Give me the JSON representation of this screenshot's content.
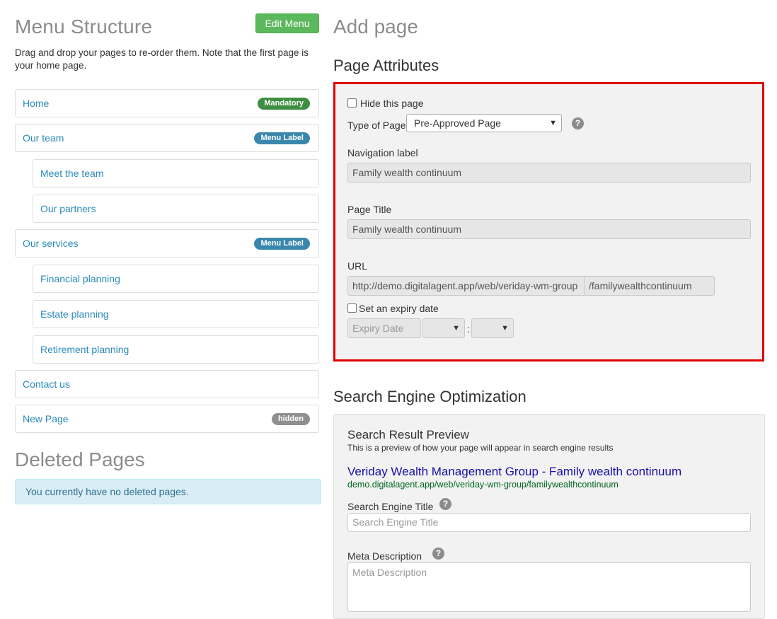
{
  "menu": {
    "heading": "Menu Structure",
    "edit_button": "Edit Menu",
    "intro": "Drag and drop your pages to re-order them. Note that the first page is your home page.",
    "items": [
      {
        "label": "Home",
        "badge": "Mandatory"
      },
      {
        "label": "Our team",
        "badge": "Menu Label"
      },
      {
        "label": "Meet the team"
      },
      {
        "label": "Our partners"
      },
      {
        "label": "Our services",
        "badge": "Menu Label"
      },
      {
        "label": "Financial planning"
      },
      {
        "label": "Estate planning"
      },
      {
        "label": "Retirement planning"
      },
      {
        "label": "Contact us"
      },
      {
        "label": "New Page",
        "badge": "hidden"
      }
    ]
  },
  "deleted": {
    "heading": "Deleted Pages",
    "message": "You currently have no deleted pages."
  },
  "add_page": {
    "heading": "Add page",
    "attributes_heading": "Page Attributes",
    "hide_page_label": "Hide this page",
    "type_label": "Type of Page:",
    "type_value": "Pre-Approved Page",
    "nav_label": "Navigation label",
    "nav_value": "Family wealth continuum",
    "title_label": "Page Title",
    "title_value": "Family wealth continuum",
    "url_label": "URL",
    "url_base": "http://demo.digitalagent.app/web/veriday-wm-group",
    "url_slug": "/familywealthcontinuum",
    "expiry_label": "Set an expiry date",
    "expiry_placeholder": "Expiry Date",
    "time_separator": ":"
  },
  "seo": {
    "heading": "Search Engine Optimization",
    "preview_heading": "Search Result Preview",
    "preview_subtext": "This is a preview of how your page will appear in search engine results",
    "preview_title": "Veriday Wealth Management Group - Family wealth continuum",
    "preview_url": "demo.digitalagent.app/web/veriday-wm-group/familywealthcontinuum",
    "se_title_label": "Search Engine Title",
    "se_title_placeholder": "Search Engine Title",
    "meta_label": "Meta Description",
    "meta_placeholder": "Meta Description"
  },
  "icons": {
    "help": "question-circle-icon",
    "dropdown": "chevron-down-icon",
    "checkbox": "checkbox-unchecked-icon"
  },
  "colors": {
    "link": "#2a8ab8",
    "success": "#5cb85c",
    "highlight_border": "#e00000",
    "serp_title": "#1a0dab",
    "serp_url": "#006621"
  }
}
